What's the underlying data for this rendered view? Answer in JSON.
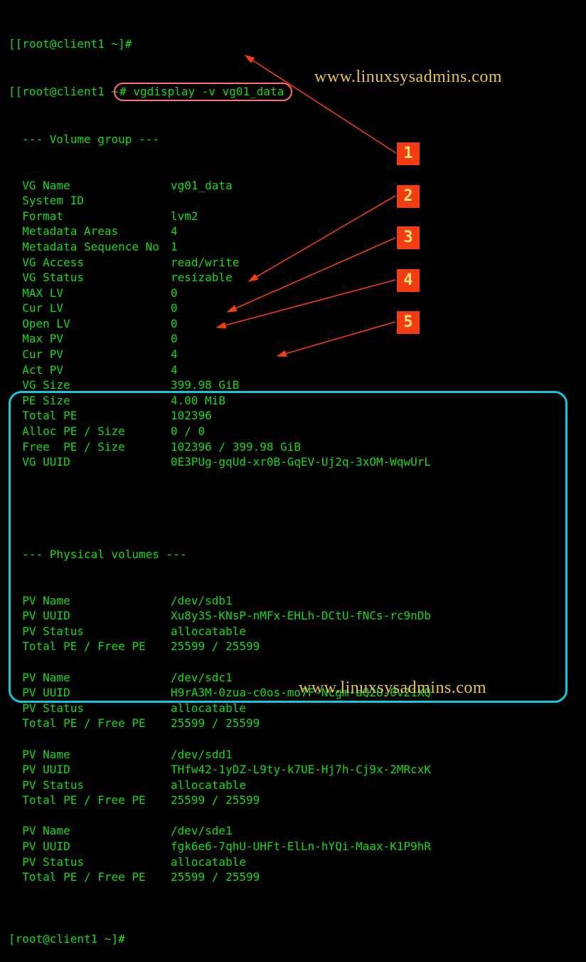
{
  "prompt1": {
    "bracket_open": "[",
    "userhost": "[root@client1 ~]",
    "hash": "#"
  },
  "prompt2": {
    "bracket_open": "[",
    "userhost": "[root@client1 ~",
    "hash": "(# ",
    "command": "vgdisplay -v vg01_data"
  },
  "prompt3": {
    "bracket_open": "[",
    "userhost": "root@client1 ~]",
    "hash": "#"
  },
  "watermark": "www.linuxsysadmins.com",
  "sections": {
    "vg_header": "  --- Volume group ---",
    "pv_header": "  --- Physical volumes ---"
  },
  "vg": [
    {
      "k": "VG Name",
      "v": "vg01_data"
    },
    {
      "k": "System ID",
      "v": ""
    },
    {
      "k": "Format",
      "v": "lvm2"
    },
    {
      "k": "Metadata Areas",
      "v": "4"
    },
    {
      "k": "Metadata Sequence No",
      "v": "1"
    },
    {
      "k": "VG Access",
      "v": "read/write"
    },
    {
      "k": "VG Status",
      "v": "resizable"
    },
    {
      "k": "MAX LV",
      "v": "0"
    },
    {
      "k": "Cur LV",
      "v": "0"
    },
    {
      "k": "Open LV",
      "v": "0"
    },
    {
      "k": "Max PV",
      "v": "0"
    },
    {
      "k": "Cur PV",
      "v": "4"
    },
    {
      "k": "Act PV",
      "v": "4"
    },
    {
      "k": "VG Size",
      "v": "399.98 GiB"
    },
    {
      "k": "PE Size",
      "v": "4.00 MiB"
    },
    {
      "k": "Total PE",
      "v": "102396"
    },
    {
      "k": "Alloc PE / Size",
      "v": "0 / 0"
    },
    {
      "k": "Free  PE / Size",
      "v": "102396 / 399.98 GiB"
    },
    {
      "k": "VG UUID",
      "v": "0E3PUg-gqUd-xr0B-GqEV-Uj2q-3xOM-WqwUrL"
    }
  ],
  "pvs": [
    {
      "name": "/dev/sdb1",
      "uuid": "Xu8y3S-KNsP-nMFx-EHLh-DCtU-fNCs-rc9nDb",
      "status": "allocatable",
      "pe": "25599 / 25599"
    },
    {
      "name": "/dev/sdc1",
      "uuid": "H9rA3M-0zua-c0os-mo7F-Ncgm-aQ2U-0v21XQ",
      "status": "allocatable",
      "pe": "25599 / 25599"
    },
    {
      "name": "/dev/sdd1",
      "uuid": "THfw42-1yDZ-L9ty-k7UE-Hj7h-Cj9x-2MRcxK",
      "status": "allocatable",
      "pe": "25599 / 25599"
    },
    {
      "name": "/dev/sde1",
      "uuid": "fgk6e6-7qhU-UHFt-ElLn-hYQi-Maax-K1P9hR",
      "status": "allocatable",
      "pe": "25599 / 25599"
    }
  ],
  "pv_labels": {
    "name": "PV Name",
    "uuid": "PV UUID",
    "status": "PV Status",
    "pe": "Total PE / Free PE"
  },
  "callouts": [
    "1",
    "2",
    "3",
    "4",
    "5"
  ]
}
